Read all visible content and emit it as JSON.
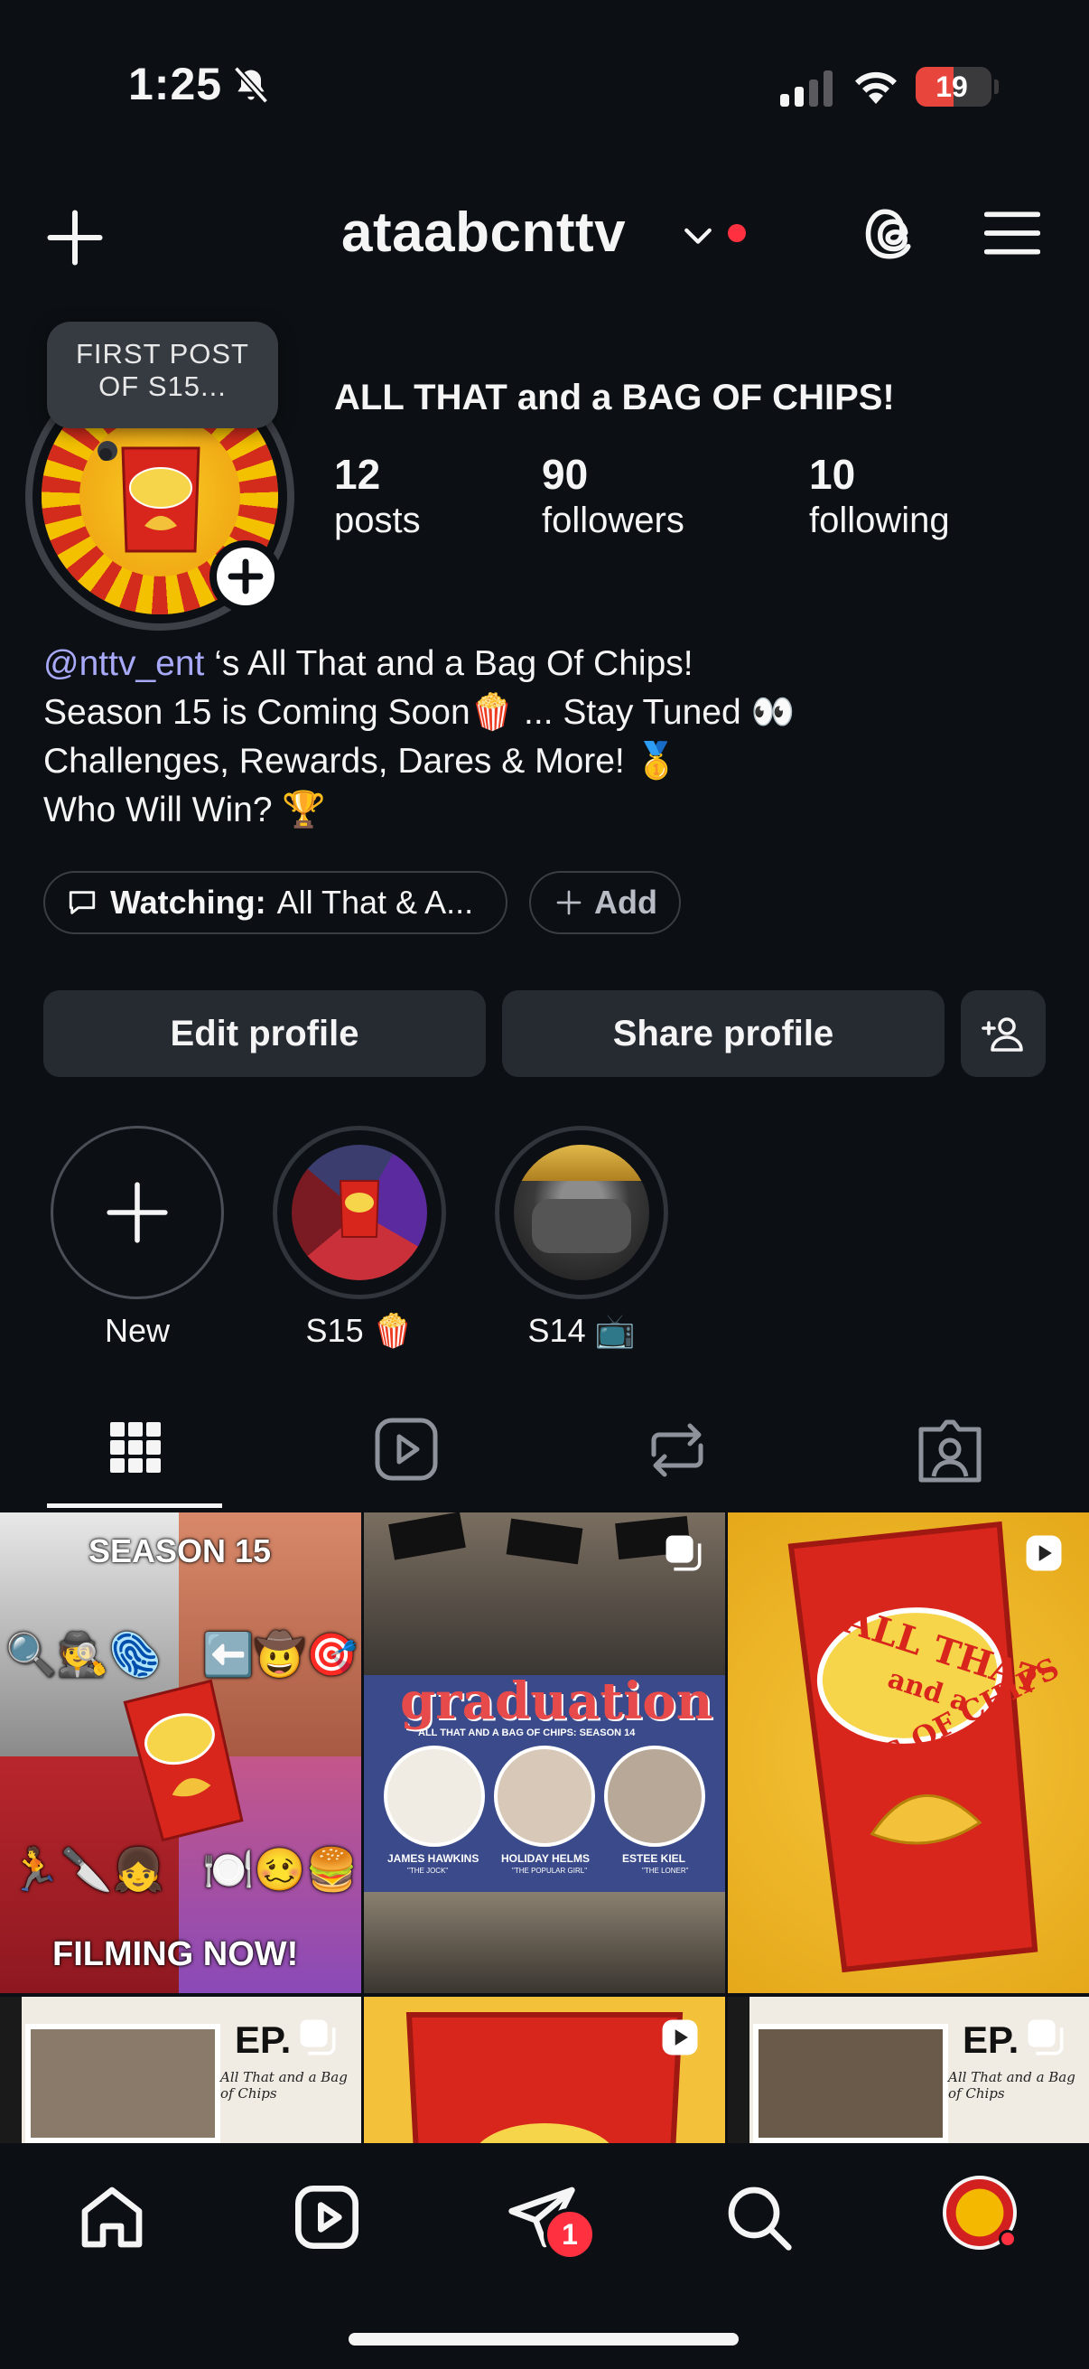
{
  "status_bar": {
    "time": "1:25",
    "battery": "19"
  },
  "header": {
    "username": "ataabcnttv"
  },
  "note": {
    "line1": "FIRST POST",
    "line2": "OF S15..."
  },
  "profile": {
    "display_name": "ALL THAT and a BAG OF CHIPS!",
    "stats": [
      {
        "number": "12",
        "label": "posts"
      },
      {
        "number": "90",
        "label": "followers"
      },
      {
        "number": "10",
        "label": "following"
      }
    ],
    "bio": {
      "mention": "@nttv_ent",
      "line1_rest": " ‘s All That and a Bag Of Chips!",
      "line2": "Season 15 is Coming Soon🍿 ... Stay Tuned 👀",
      "line3": "Challenges, Rewards, Dares & More! 🥇",
      "line4": "Who Will Win? 🏆"
    },
    "watching_label": "Watching:",
    "watching_value": "All That & A...",
    "add_label": "Add"
  },
  "buttons": {
    "edit": "Edit profile",
    "share": "Share profile"
  },
  "highlights": [
    {
      "label": "New"
    },
    {
      "label": "S15 🍿"
    },
    {
      "label": "S14 📺"
    }
  ],
  "grid": {
    "post1_top": "SEASON 15",
    "post1_bottom": "FILMING NOW!",
    "post1_emoji_a": "🔍🕵️🫆",
    "post1_emoji_b": "⬅️🤠🎯",
    "post1_emoji_c": "🏃🔪👧",
    "post1_emoji_d": "🍽️🥴🍔",
    "post2_title": "graduation",
    "post2_subtitle": "ALL THAT AND A BAG OF CHIPS: SEASON 14",
    "post2_names": [
      "JAMES HAWKINS",
      "HOLIDAY HELMS",
      "ESTEE KIEL"
    ],
    "post2_roles": [
      "\"THE JOCK\"",
      "\"THE POPULAR GIRL\"",
      "\"THE LONER\""
    ],
    "post3_text1": "ALL THAT",
    "post3_text2": "and a",
    "post3_text3": "BAG OF CHIPS",
    "post4_ep": "EP.",
    "post4_sub": "All That and a Bag of Chips",
    "post6_ep": "EP.",
    "post6_sub": "All That and a Bag of Chips"
  },
  "bottom_nav": {
    "badge": "1"
  },
  "colors": {
    "background": "#0c1014",
    "accent_red": "#ff3040",
    "mention": "#a8a9f8",
    "button": "#262a31"
  }
}
